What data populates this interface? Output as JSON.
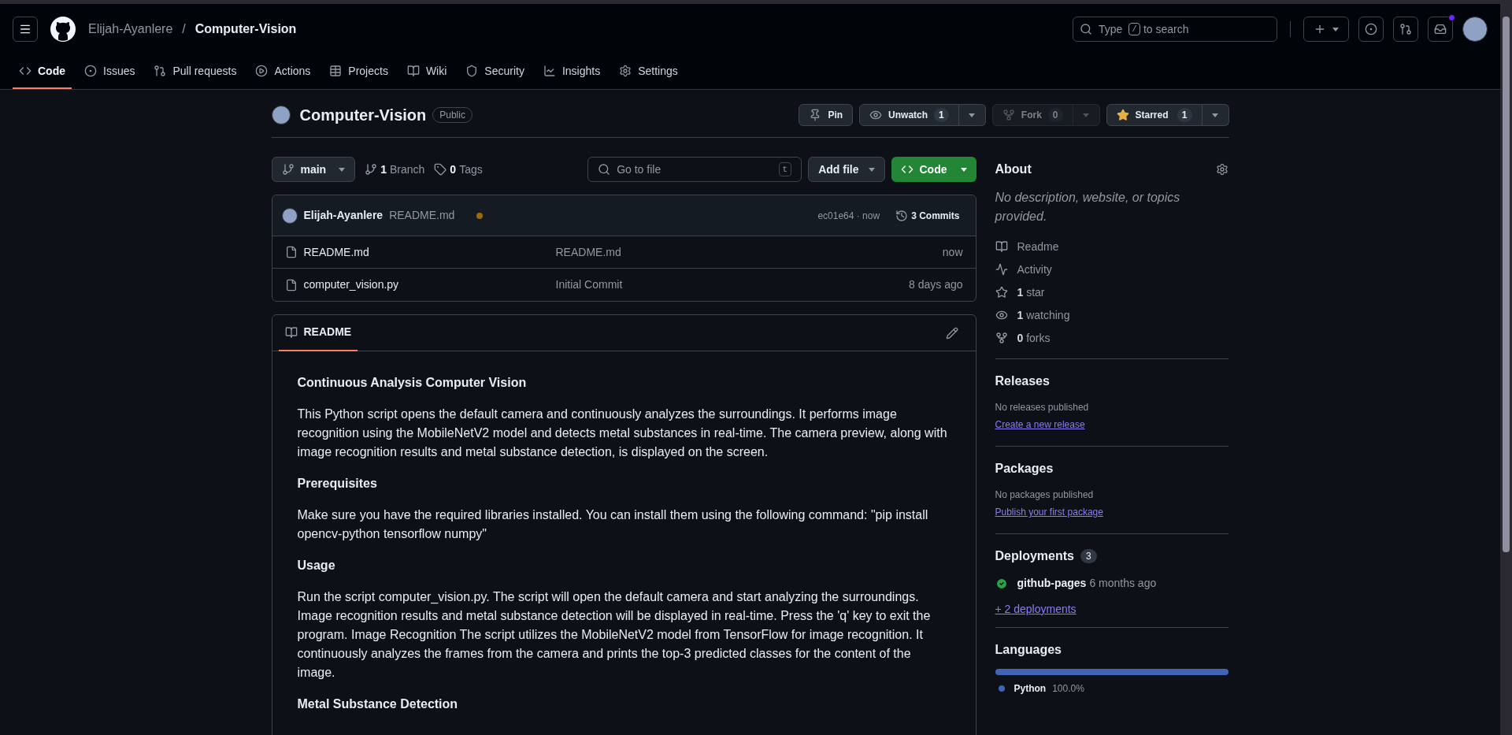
{
  "header": {
    "owner": "Elijah-Ayanlere",
    "separator": "/",
    "repo": "Computer-Vision",
    "search": {
      "prefix": "Type",
      "key": "/",
      "suffix": "to search"
    },
    "notification": true
  },
  "nav_tabs": [
    {
      "kind": "code",
      "label": "Code",
      "selected": true
    },
    {
      "kind": "issues",
      "label": "Issues",
      "selected": false
    },
    {
      "kind": "pulls",
      "label": "Pull requests",
      "selected": false
    },
    {
      "kind": "actions",
      "label": "Actions",
      "selected": false
    },
    {
      "kind": "projects",
      "label": "Projects",
      "selected": false
    },
    {
      "kind": "wiki",
      "label": "Wiki",
      "selected": false
    },
    {
      "kind": "security",
      "label": "Security",
      "selected": false
    },
    {
      "kind": "insights",
      "label": "Insights",
      "selected": false
    },
    {
      "kind": "settings",
      "label": "Settings",
      "selected": false
    }
  ],
  "repo": {
    "name": "Computer-Vision",
    "visibility": "Public",
    "actions": [
      {
        "kind": "pin",
        "label": "Pin",
        "disabled": false
      },
      {
        "kind": "watch",
        "label": "Unwatch",
        "count": "1",
        "disabled": false
      },
      {
        "kind": "fork",
        "label": "Fork",
        "count": "0",
        "disabled": true
      },
      {
        "kind": "star",
        "label": "Starred",
        "count": "1",
        "disabled": false
      }
    ]
  },
  "toolbar": {
    "branch": "main",
    "branches": {
      "count": "1",
      "label": "Branch"
    },
    "tags": {
      "count": "0",
      "label": "Tags"
    },
    "go_to_file": {
      "placeholder": "Go to file",
      "key": "t"
    },
    "add_file": "Add file",
    "code": "Code"
  },
  "commit": {
    "author": "Elijah-Ayanlere",
    "message": "README.md",
    "pending": true,
    "hash_time": "ec01e64 · now",
    "commits": "3 Commits"
  },
  "files": [
    {
      "name": "README.md",
      "message": "README.md",
      "time": "now"
    },
    {
      "name": "computer_vision.py",
      "message": "Initial Commit",
      "time": "8 days ago"
    }
  ],
  "readme": {
    "tab": "README",
    "blocks": [
      {
        "kind": "heading",
        "text": "Continuous Analysis Computer Vision"
      },
      {
        "kind": "paragraph",
        "text": "This Python script opens the default camera and continuously analyzes the surroundings. It performs image recognition using the MobileNetV2 model and detects metal substances in real-time. The camera preview, along with image recognition results and metal substance detection, is displayed on the screen."
      },
      {
        "kind": "heading",
        "text": "Prerequisites"
      },
      {
        "kind": "paragraph",
        "text": "Make sure you have the required libraries installed. You can install them using the following command: \"pip install opencv-python tensorflow numpy\""
      },
      {
        "kind": "heading",
        "text": "Usage"
      },
      {
        "kind": "paragraph",
        "text": "Run the script computer_vision.py. The script will open the default camera and start analyzing the surroundings. Image recognition results and metal substance detection will be displayed in real-time. Press the 'q' key to exit the program. Image Recognition The script utilizes the MobileNetV2 model from TensorFlow for image recognition. It continuously analyzes the frames from the camera and prints the top-3 predicted classes for the content of the image."
      },
      {
        "kind": "heading",
        "text": "Metal Substance Detection"
      }
    ]
  },
  "about": {
    "title": "About",
    "description": "No description, website, or topics provided.",
    "items": [
      {
        "kind": "readme",
        "label": "Readme"
      },
      {
        "kind": "activity",
        "label": "Activity"
      },
      {
        "kind": "stars",
        "count": "1",
        "label": "star"
      },
      {
        "kind": "watching",
        "count": "1",
        "label": "watching"
      },
      {
        "kind": "forks",
        "count": "0",
        "label": "forks"
      }
    ]
  },
  "releases": {
    "title": "Releases",
    "note": "No releases published",
    "link": "Create a new release"
  },
  "packages": {
    "title": "Packages",
    "note": "No packages published",
    "link": "Publish your first package"
  },
  "deployments": {
    "title": "Deployments",
    "count": "3",
    "items": [
      {
        "name": "github-pages",
        "time": "6 months ago",
        "succeeded": true
      }
    ],
    "more": "+ 2 deployments"
  },
  "languages": {
    "title": "Languages",
    "items": [
      {
        "name": "Python",
        "percent": "100.0%",
        "color": "#4063b3",
        "level": 1
      }
    ]
  }
}
